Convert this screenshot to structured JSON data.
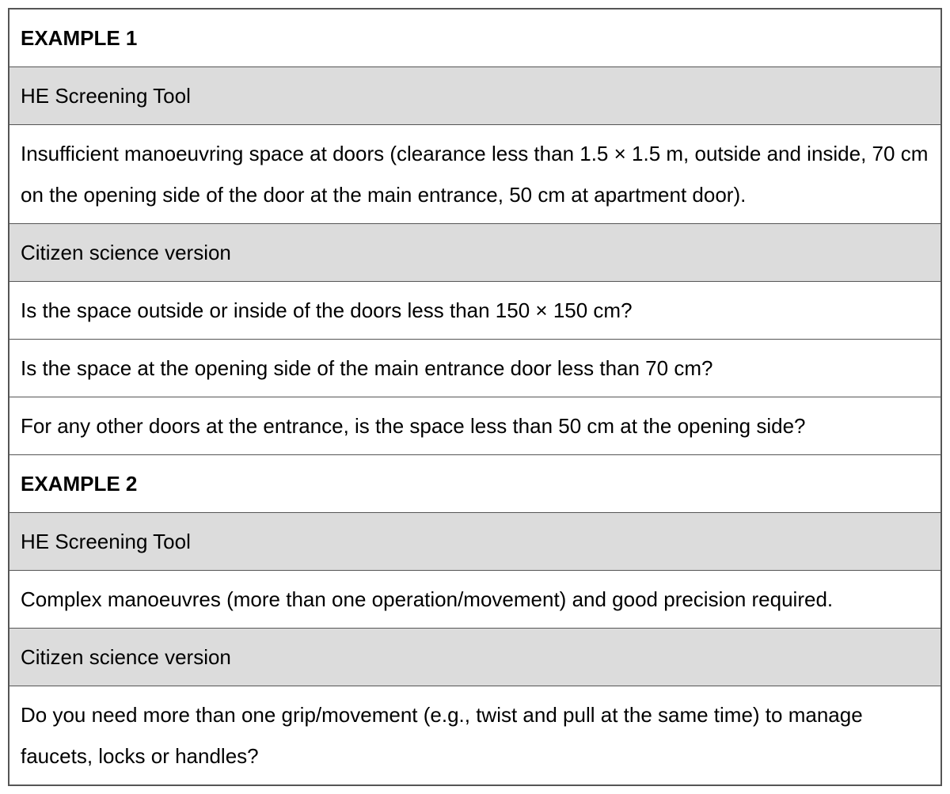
{
  "rows": [
    {
      "text": "EXAMPLE 1",
      "bold": true,
      "shaded": false
    },
    {
      "text": "HE Screening Tool",
      "bold": false,
      "shaded": true
    },
    {
      "text": "Insufficient manoeuvring space at doors (clearance less than 1.5 × 1.5 m, outside and inside, 70 cm on the opening side of the door at the main entrance, 50 cm at apartment door).",
      "bold": false,
      "shaded": false
    },
    {
      "text": "Citizen science version",
      "bold": false,
      "shaded": true
    },
    {
      "text": "Is the space outside or inside of the doors less than 150 × 150 cm?",
      "bold": false,
      "shaded": false
    },
    {
      "text": "Is the space at the opening side of the main entrance door less than 70 cm?",
      "bold": false,
      "shaded": false
    },
    {
      "text": "For any other doors at the entrance, is the space less than 50 cm at the opening side?",
      "bold": false,
      "shaded": false
    },
    {
      "text": "EXAMPLE 2",
      "bold": true,
      "shaded": false
    },
    {
      "text": "HE Screening Tool",
      "bold": false,
      "shaded": true
    },
    {
      "text": "Complex manoeuvres (more than one operation/movement) and good precision required.",
      "bold": false,
      "shaded": false
    },
    {
      "text": "Citizen science version",
      "bold": false,
      "shaded": true
    },
    {
      "text": "Do you need more than one grip/movement (e.g., twist and pull at the same time) to manage faucets, locks or handles?",
      "bold": false,
      "shaded": false
    }
  ]
}
